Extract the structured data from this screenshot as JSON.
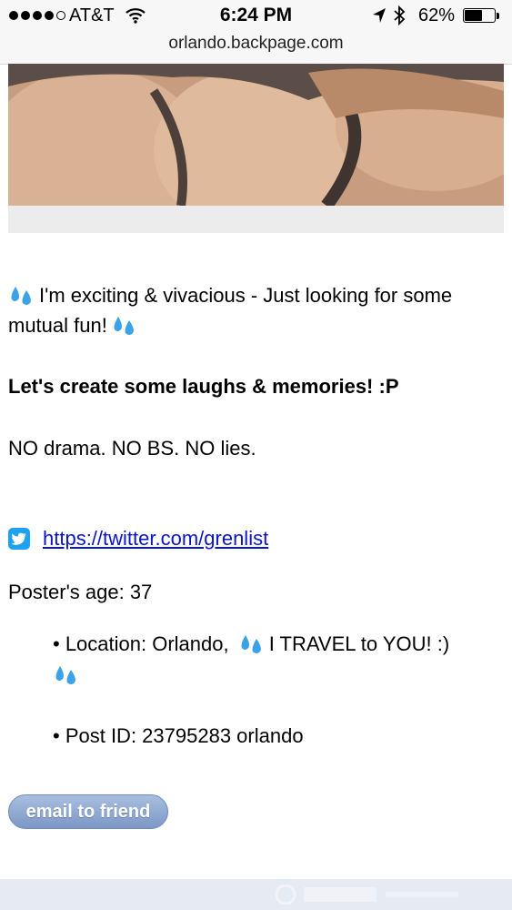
{
  "status_bar": {
    "carrier": "AT&T",
    "time": "6:24 PM",
    "battery_percent": "62%",
    "battery_level": 0.62,
    "signal_bars": 4
  },
  "browser": {
    "url": "orlando.backpage.com"
  },
  "ad": {
    "intro": "I'm exciting & vivacious - Just looking for some mutual fun!",
    "headline": "Let's create some laughs & memories! :P",
    "no_drama": "NO drama. NO BS. NO lies.",
    "twitter_link": "https://twitter.com/grenlist",
    "poster_age": "Poster's age: 37",
    "location_prefix": "• Location: Orlando,",
    "location_suffix": "I TRAVEL to YOU! :)",
    "post_id": "• Post ID: 23795283 orlando",
    "email_button": "email to friend"
  },
  "icons": {
    "emoji": "sweat-droplets-icon",
    "twitter": "twitter-icon"
  },
  "colors": {
    "link": "#0a14c8",
    "twitter_blue": "#1da1f2",
    "email_button": "#8aa5d0",
    "emoji_blue": "#3aa3e8"
  }
}
